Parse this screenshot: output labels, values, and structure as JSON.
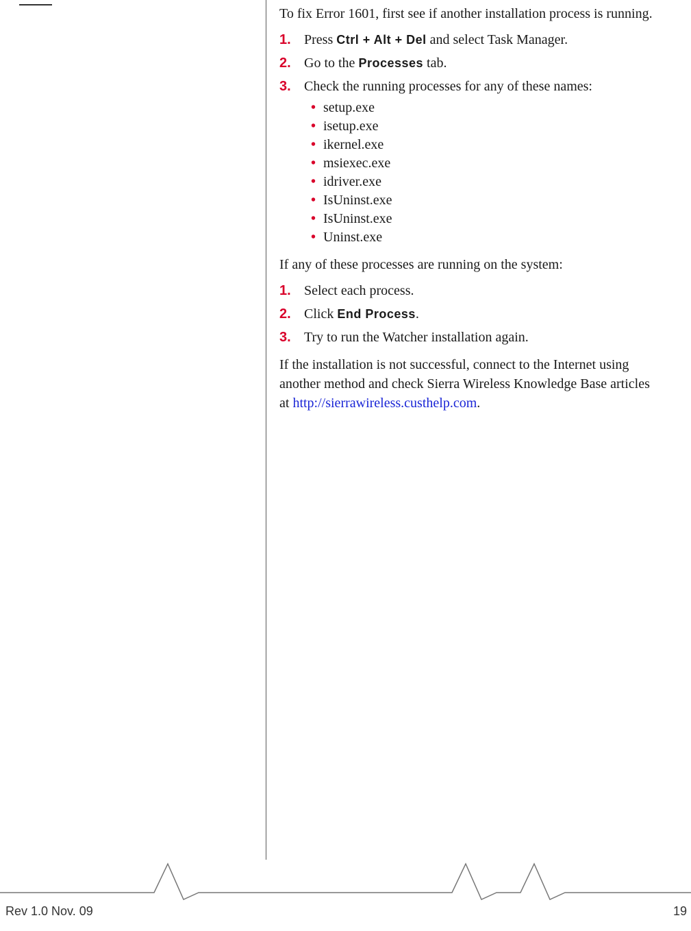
{
  "intro": "To fix Error 1601, first see if another installation process is running.",
  "steps1": [
    {
      "pre": "Press ",
      "kbd": "Ctrl + Alt + Del",
      "post": " and select Task Manager."
    },
    {
      "pre": "Go to the ",
      "kbd": "Processes",
      "post": " tab."
    },
    {
      "pre": "Check the running processes for any of these names:",
      "kbd": "",
      "post": ""
    }
  ],
  "processes": [
    "setup.exe",
    "isetup.exe",
    "ikernel.exe",
    "msiexec.exe",
    "idriver.exe",
    "IsUninst.exe",
    "IsUninst.exe",
    "Uninst.exe"
  ],
  "mid": "If any of these processes are running on the system:",
  "steps2": [
    {
      "pre": "Select each process.",
      "kbd": "",
      "post": ""
    },
    {
      "pre": "Click ",
      "kbd": "End Process",
      "post": "."
    },
    {
      "pre": "Try to run the Watcher installation again.",
      "kbd": "",
      "post": ""
    }
  ],
  "outro_pre": "If the installation is not successful, connect to the Internet using another method and check Sierra Wireless Knowledge Base articles at ",
  "outro_link": "http://sierrawireless.custhelp.com",
  "outro_post": ".",
  "footer": {
    "rev": "Rev 1.0  Nov. 09",
    "page": "19"
  }
}
